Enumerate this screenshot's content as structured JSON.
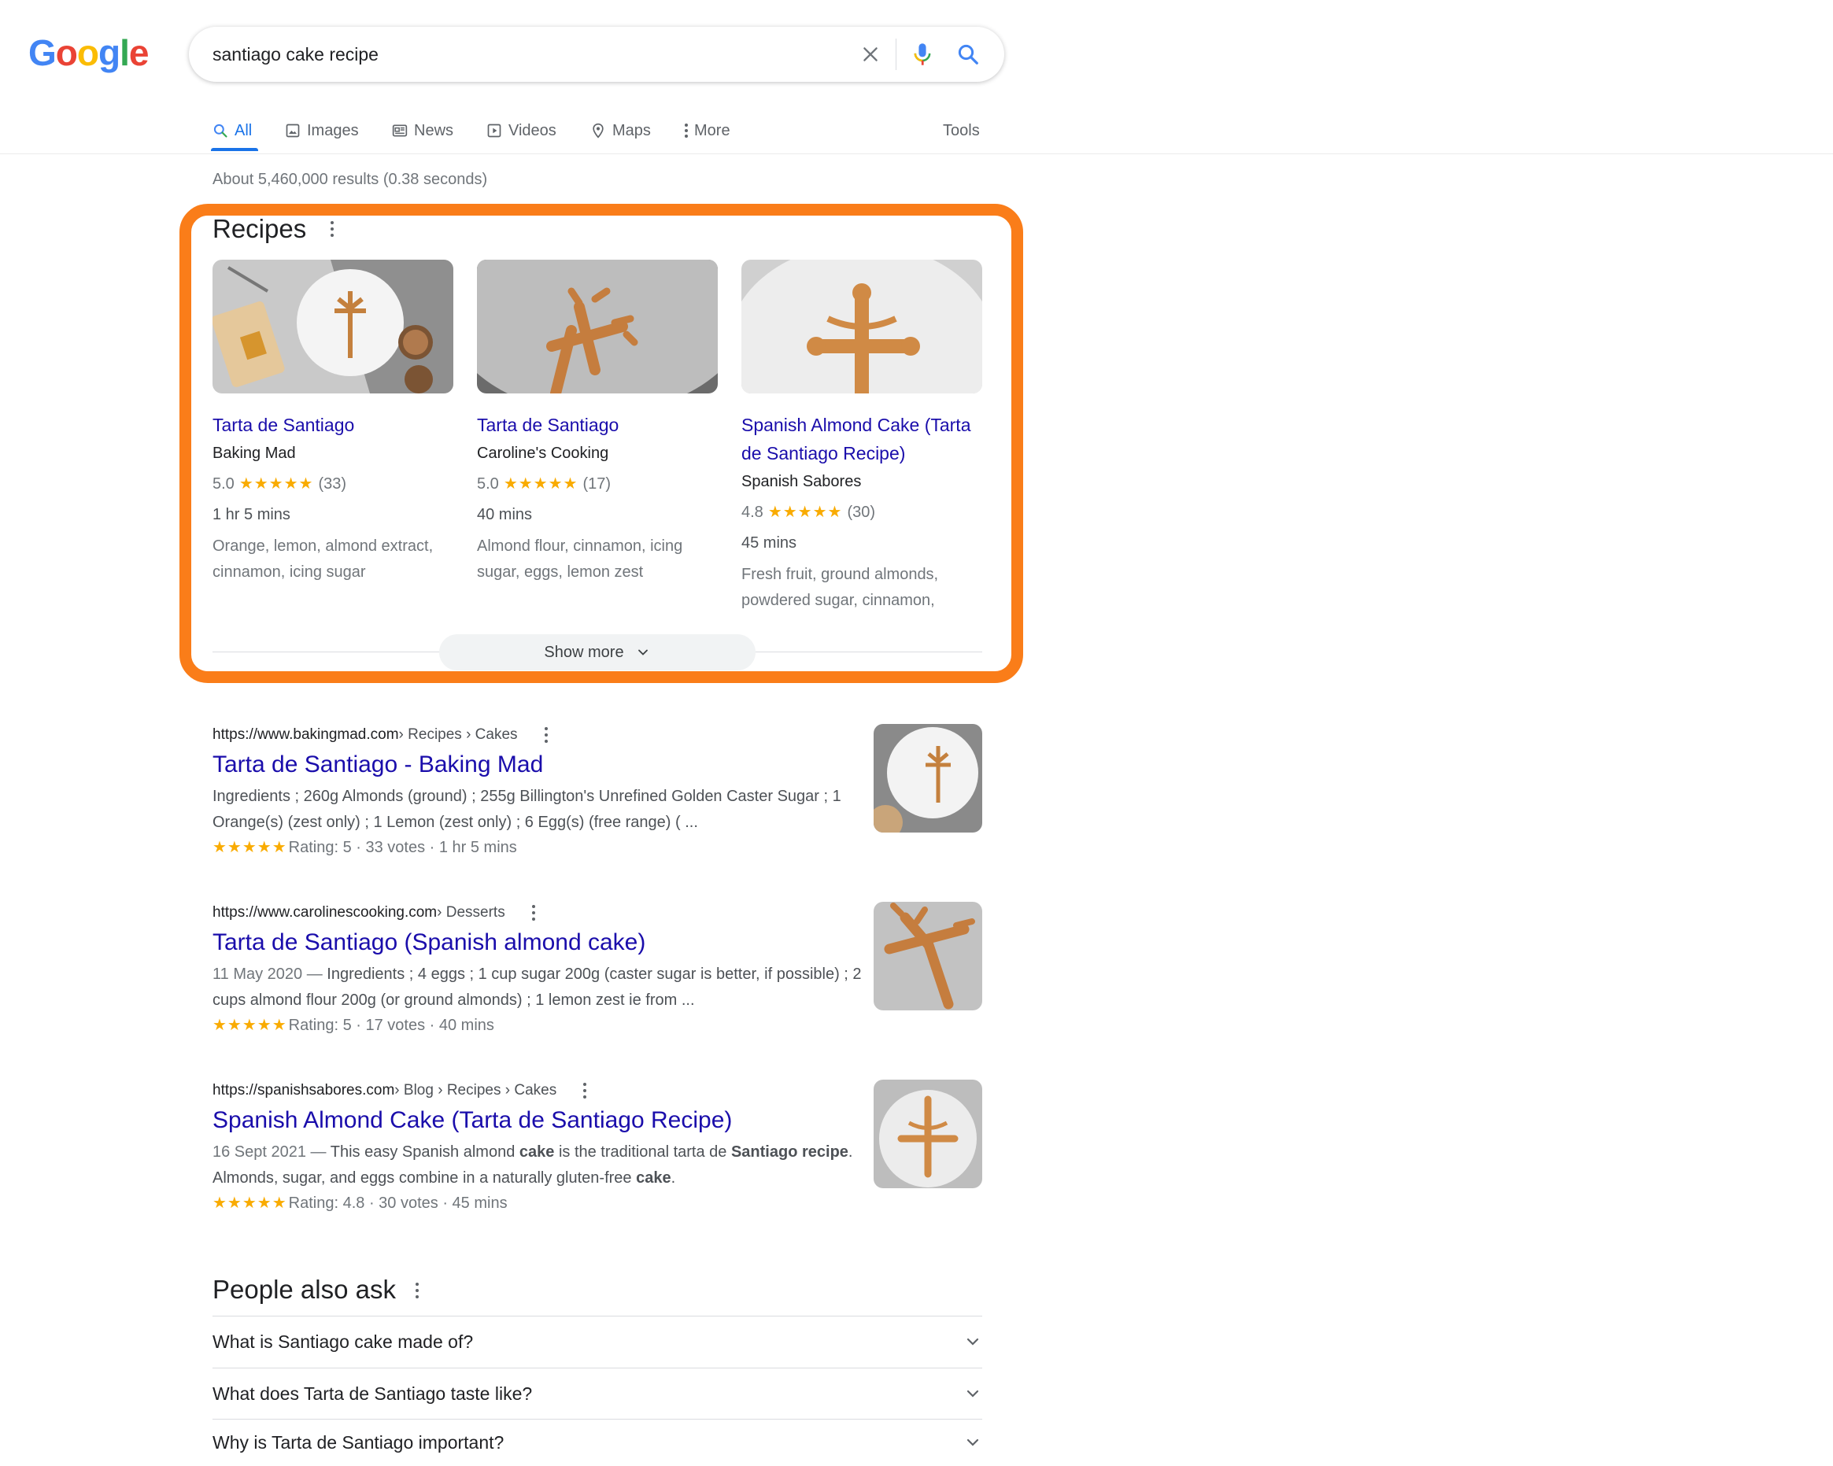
{
  "logo": {
    "letters": [
      "G",
      "o",
      "o",
      "g",
      "l",
      "e"
    ],
    "colors": [
      "#4285f4",
      "#ea4335",
      "#fbbc05",
      "#4285f4",
      "#34a853",
      "#ea4335"
    ]
  },
  "search": {
    "value": "santiago cake recipe"
  },
  "tabs": [
    {
      "label": "All",
      "icon": "search-icon"
    },
    {
      "label": "Images",
      "icon": "image-icon"
    },
    {
      "label": "News",
      "icon": "newspaper-icon"
    },
    {
      "label": "Videos",
      "icon": "play-icon"
    },
    {
      "label": "Maps",
      "icon": "map-pin-icon"
    },
    {
      "label": "More",
      "icon": "kebab-icon"
    },
    {
      "label": "Tools"
    }
  ],
  "result_stats": "About 5,460,000 results (0.38 seconds)",
  "recipes": {
    "title": "Recipes",
    "show_more": "Show more",
    "cards": [
      {
        "title": "Tarta de Santiago",
        "source": "Baking Mad",
        "rating": "5.0",
        "stars": "★★★★★",
        "votes": "(33)",
        "time": "1 hr 5 mins",
        "ingredients": "Orange, lemon, almond extract, cinnamon, icing sugar"
      },
      {
        "title": "Tarta de Santiago",
        "source": "Caroline's Cooking",
        "rating": "5.0",
        "stars": "★★★★★",
        "votes": "(17)",
        "time": "40 mins",
        "ingredients": "Almond flour, cinnamon, icing sugar, eggs, lemon zest"
      },
      {
        "title": "Spanish Almond Cake (Tarta de Santiago Recipe)",
        "source": "Spanish Sabores",
        "rating": "4.8",
        "stars": "★★★★★",
        "votes": "(30)",
        "time": "45 mins",
        "ingredients": "Fresh fruit, ground almonds, powdered sugar, cinnamon,"
      }
    ]
  },
  "results": [
    {
      "domain": "https://www.bakingmad.com",
      "crumbs": " › Recipes › Cakes",
      "title": "Tarta de Santiago - Baking Mad",
      "snippet": "Ingredients ; 260g Almonds (ground) ; 255g Billington's Unrefined Golden Caster Sugar ; 1 Orange(s) (zest only) ; 1 Lemon (zest only) ; 6 Egg(s) (free range) ( ...",
      "stars": "★★★★★",
      "meta": "Rating: 5 · 33 votes · 1 hr 5 mins"
    },
    {
      "domain": "https://www.carolinescooking.com",
      "crumbs": " › Desserts",
      "title": "Tarta de Santiago (Spanish almond cake)",
      "date": "11 May 2020 — ",
      "snippet": "Ingredients ; 4 eggs ; 1 cup sugar 200g (caster sugar is better, if possible) ; 2 cups almond flour 200g (or ground almonds) ; 1 lemon zest ie from ...",
      "stars": "★★★★★",
      "meta": "Rating: 5 · 17 votes · 40 mins"
    },
    {
      "domain": "https://spanishsabores.com",
      "crumbs": " › Blog › Recipes › Cakes",
      "title": "Spanish Almond Cake (Tarta de Santiago Recipe)",
      "date": "16 Sept 2021 — ",
      "snippet_parts": [
        "This easy Spanish almond ",
        "cake",
        " is the traditional tarta de ",
        "Santiago",
        " ",
        "recipe",
        ". Almonds, sugar, and eggs combine in a naturally gluten-free ",
        "cake",
        "."
      ],
      "stars": "★★★★★",
      "meta": "Rating: 4.8 · 30 votes · 45 mins"
    }
  ],
  "paa": {
    "title": "People also ask",
    "questions": [
      "What is Santiago cake made of?",
      "What does Tarta de Santiago taste like?",
      "Why is Tarta de Santiago important?"
    ]
  },
  "colors": {
    "accent": "#1a73e8",
    "link": "#1a0dab",
    "highlight_border": "#fa7d19",
    "star": "#f9ab00"
  }
}
